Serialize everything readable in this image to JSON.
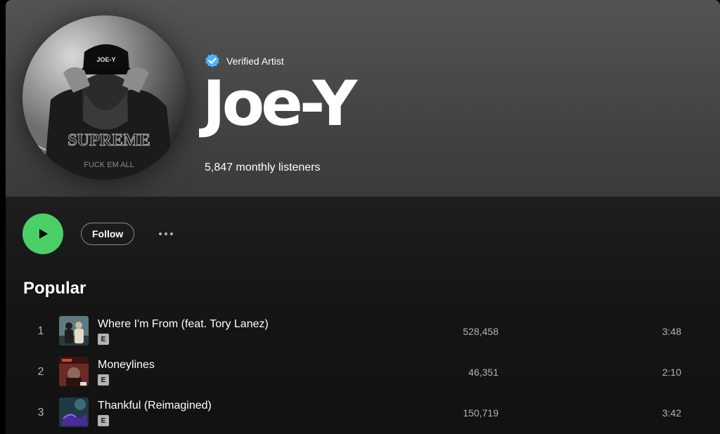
{
  "artist": {
    "verified_label": "Verified Artist",
    "name": "Joe-Y",
    "monthly_listeners": "5,847 monthly listeners",
    "avatar_caption_lines": [
      "JOE-Y",
      "SUPREME",
      "FUCK EM ALL"
    ]
  },
  "actions": {
    "play_icon": "play-icon",
    "follow_label": "Follow",
    "more_icon": "more-options-icon"
  },
  "popular": {
    "title": "Popular",
    "tracks": [
      {
        "number": "1",
        "title": "Where I'm From (feat. Tory Lanez)",
        "explicit": "E",
        "plays": "528,458",
        "duration": "3:48"
      },
      {
        "number": "2",
        "title": "Moneylines",
        "explicit": "E",
        "plays": "46,351",
        "duration": "2:10"
      },
      {
        "number": "3",
        "title": "Thankful (Reimagined)",
        "explicit": "E",
        "plays": "150,719",
        "duration": "3:42"
      }
    ]
  },
  "colors": {
    "accent_green": "#4ad067",
    "verified_blue": "#4cb3ff",
    "secondary_text": "#b3b3b3",
    "background": "#121212"
  }
}
